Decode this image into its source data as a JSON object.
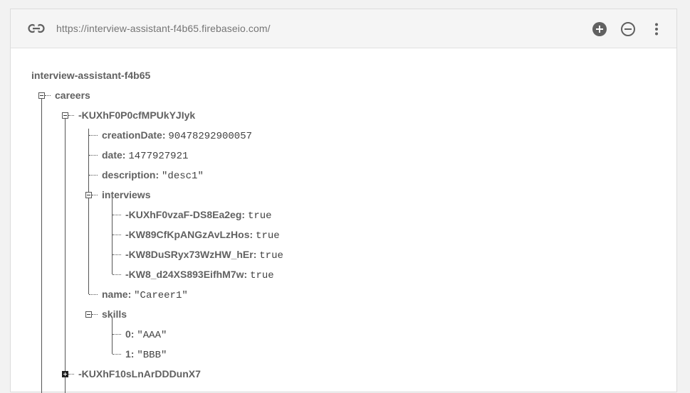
{
  "toolbar": {
    "url": "https://interview-assistant-f4b65.firebaseio.com/",
    "icons": [
      "link-icon",
      "add-circle-icon",
      "remove-circle-icon",
      "more-vert-icon"
    ]
  },
  "tree": {
    "root": "interview-assistant-f4b65",
    "careers_key": "careers",
    "career1_key": "-KUXhF0P0cfMPUkYJIyk",
    "creationDate": {
      "key": "creationDate",
      "value": "90478292900057"
    },
    "date": {
      "key": "date",
      "value": "1477927921"
    },
    "description": {
      "key": "description",
      "value": "\"desc1\""
    },
    "interviews_key": "interviews",
    "interviews": [
      {
        "key": "-KUXhF0vzaF-DS8Ea2eg",
        "value": "true"
      },
      {
        "key": "-KW89CfKpANGzAvLzHos",
        "value": "true"
      },
      {
        "key": "-KW8DuSRyx73WzHW_hEr",
        "value": "true"
      },
      {
        "key": "-KW8_d24XS893EifhM7w",
        "value": "true"
      }
    ],
    "name": {
      "key": "name",
      "value": "\"Career1\""
    },
    "skills_key": "skills",
    "skills": [
      {
        "key": "0",
        "value": "\"AAA\""
      },
      {
        "key": "1",
        "value": "\"BBB\""
      }
    ],
    "career2_key": "-KUXhF10sLnArDDDunX7"
  },
  "separator": ":"
}
